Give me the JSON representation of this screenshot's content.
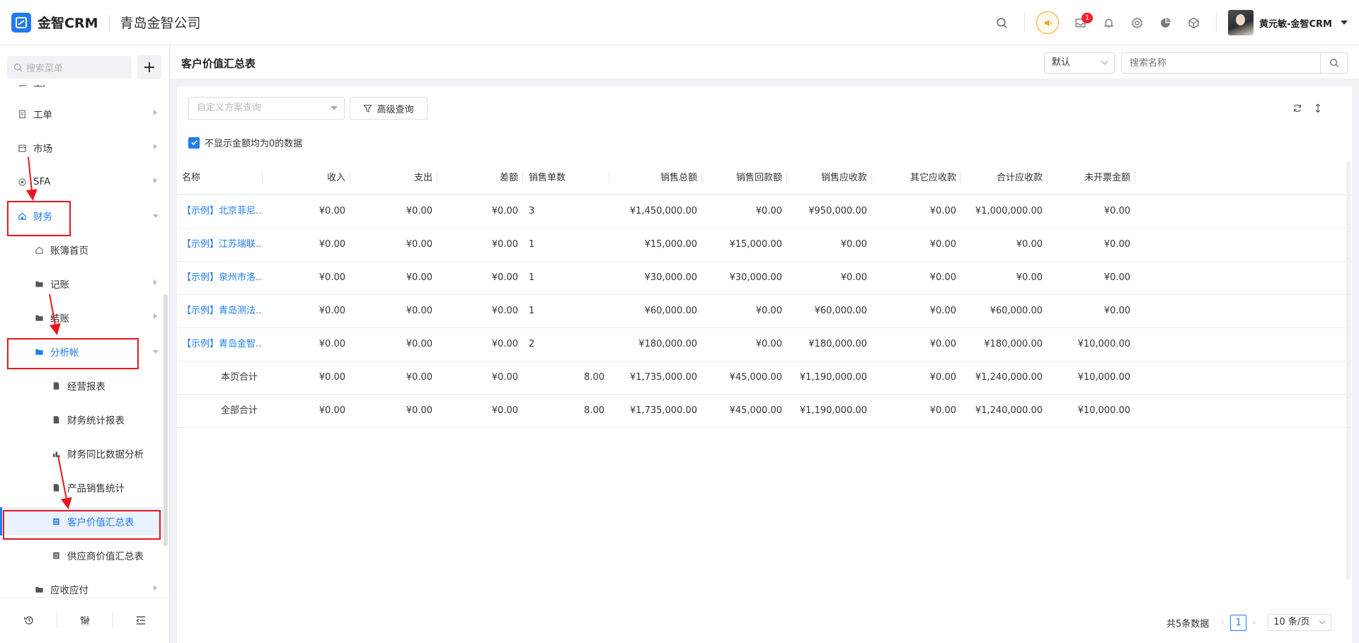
{
  "app": {
    "logo_text": "金智CRM",
    "company": "青岛金智公司"
  },
  "topbar": {
    "notification_count": "1",
    "user_name": "黄元敏-金智CRM"
  },
  "sidebar": {
    "search_placeholder": "搜索菜单",
    "add_symbol": "+",
    "items": [
      {
        "label": "生产"
      },
      {
        "label": "工单"
      },
      {
        "label": "市场"
      },
      {
        "label": "SFA"
      },
      {
        "label": "财务"
      },
      {
        "label": "账簿首页"
      },
      {
        "label": "记账"
      },
      {
        "label": "结账"
      },
      {
        "label": "分析帐"
      },
      {
        "label": "经营报表"
      },
      {
        "label": "财务统计报表"
      },
      {
        "label": "财务同比数据分析"
      },
      {
        "label": "产品销售统计"
      },
      {
        "label": "客户价值汇总表"
      },
      {
        "label": "供应商价值汇总表"
      },
      {
        "label": "应收应付"
      }
    ]
  },
  "header": {
    "title": "客户价值汇总表",
    "view_select": "默认",
    "search_placeholder": "搜索名称"
  },
  "filters": {
    "scheme_placeholder": "自定义方案查询",
    "advanced_label": "高级查询",
    "hide_zero_label": "不显示金额均为0的数据"
  },
  "table": {
    "columns": [
      "名称",
      "收入",
      "支出",
      "差额",
      "销售单数",
      "销售总额",
      "销售回款额",
      "销售应收款",
      "其它应收款",
      "合计应收款",
      "未开票金额"
    ],
    "rows": [
      [
        "【示例】北京菲尼...",
        "¥0.00",
        "¥0.00",
        "¥0.00",
        "3",
        "¥1,450,000.00",
        "¥0.00",
        "¥950,000.00",
        "¥0.00",
        "¥1,000,000.00",
        "¥0.00"
      ],
      [
        "【示例】江苏瑞联...",
        "¥0.00",
        "¥0.00",
        "¥0.00",
        "1",
        "¥15,000.00",
        "¥15,000.00",
        "¥0.00",
        "¥0.00",
        "¥0.00",
        "¥0.00"
      ],
      [
        "【示例】泉州市洛...",
        "¥0.00",
        "¥0.00",
        "¥0.00",
        "1",
        "¥30,000.00",
        "¥30,000.00",
        "¥0.00",
        "¥0.00",
        "¥0.00",
        "¥0.00"
      ],
      [
        "【示例】青岛测法...",
        "¥0.00",
        "¥0.00",
        "¥0.00",
        "1",
        "¥60,000.00",
        "¥0.00",
        "¥60,000.00",
        "¥0.00",
        "¥60,000.00",
        "¥0.00"
      ],
      [
        "【示例】青岛金智...",
        "¥0.00",
        "¥0.00",
        "¥0.00",
        "2",
        "¥180,000.00",
        "¥0.00",
        "¥180,000.00",
        "¥0.00",
        "¥180,000.00",
        "¥10,000.00"
      ]
    ],
    "totals": [
      [
        "本页合计",
        "¥0.00",
        "¥0.00",
        "¥0.00",
        "8.00",
        "¥1,735,000.00",
        "¥45,000.00",
        "¥1,190,000.00",
        "¥0.00",
        "¥1,240,000.00",
        "¥10,000.00"
      ],
      [
        "全部合计",
        "¥0.00",
        "¥0.00",
        "¥0.00",
        "8.00",
        "¥1,735,000.00",
        "¥45,000.00",
        "¥1,190,000.00",
        "¥0.00",
        "¥1,240,000.00",
        "¥10,000.00"
      ]
    ]
  },
  "pagination": {
    "total_text": "共5条数据",
    "current_page": "1",
    "page_size": "10 条/页"
  },
  "colors": {
    "accent": "#1f7cf1",
    "annotation": "#e8161e",
    "warning": "#f5a623"
  }
}
